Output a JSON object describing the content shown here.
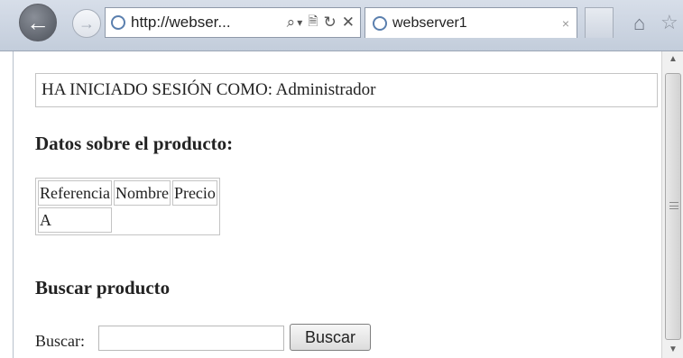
{
  "browser": {
    "address_url": "http://webser...",
    "address_icons": [
      "search-icon",
      "dropdown-icon",
      "compatibility-icon",
      "refresh-icon",
      "stop-icon"
    ],
    "search_glyph": "⌕",
    "dropdown_glyph": "▾",
    "compat_glyph": "🗎",
    "refresh_glyph": "↻",
    "stop_glyph": "✕",
    "back_glyph": "←",
    "forward_glyph": "→",
    "tab_title": "webserver1",
    "tab_close_glyph": "×",
    "home_glyph": "⌂",
    "favorites_glyph": "☆"
  },
  "page": {
    "session_text": "HA INICIADO SESIÓN COMO: Administrador",
    "product_heading": "Datos sobre el producto:",
    "table": {
      "headers": [
        "Referencia",
        "Nombre",
        "Precio"
      ],
      "rows": [
        [
          "A"
        ]
      ]
    },
    "search_heading": "Buscar producto",
    "search_label": "Buscar:",
    "search_value": "",
    "search_button": "Buscar"
  },
  "scrollbar": {
    "up_glyph": "▲",
    "down_glyph": "▼"
  },
  "colors": {
    "toolbar": "#c3cddb",
    "border": "#c4c4c4"
  }
}
